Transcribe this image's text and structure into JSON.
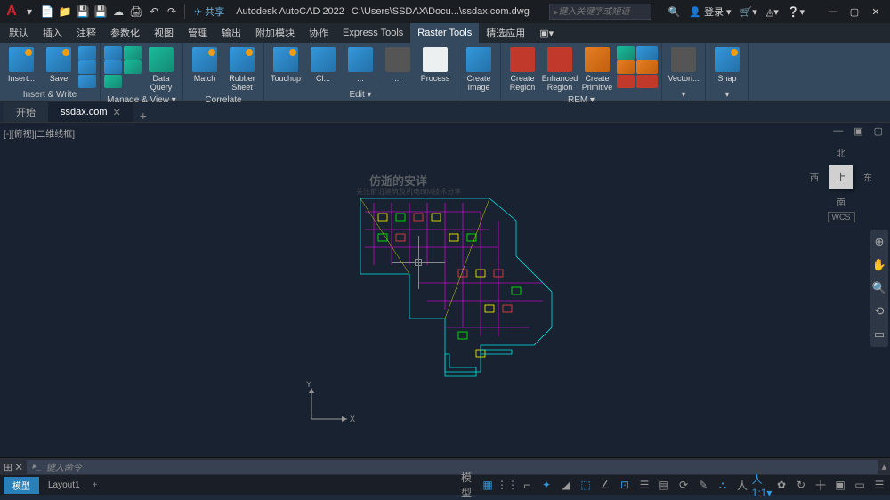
{
  "title": {
    "app": "Autodesk AutoCAD 2022",
    "file": "C:\\Users\\SSDAX\\Docu...\\ssdax.com.dwg",
    "share": "共享",
    "search_placeholder": "键入关键字或短语",
    "login": "登录"
  },
  "menu": {
    "items": [
      "默认",
      "插入",
      "注释",
      "参数化",
      "视图",
      "管理",
      "输出",
      "附加模块",
      "协作",
      "Express Tools",
      "Raster Tools",
      "精选应用"
    ],
    "active_index": 10
  },
  "ribbon": {
    "groups": [
      {
        "label": "Insert & Write",
        "buttons": [
          {
            "l": "Insert..."
          },
          {
            "l": "Save"
          }
        ]
      },
      {
        "label": "Manage & View ▾",
        "buttons": [
          {
            "l": "Data Query"
          }
        ]
      },
      {
        "label": "Correlate",
        "buttons": [
          {
            "l": "Match"
          },
          {
            "l": "Rubber Sheet"
          }
        ]
      },
      {
        "label": "Edit ▾",
        "buttons": [
          {
            "l": "Touchup"
          },
          {
            "l": "Cl..."
          },
          {
            "l": "..."
          },
          {
            "l": "..."
          },
          {
            "l": "Process"
          }
        ]
      },
      {
        "label": "",
        "buttons": [
          {
            "l": "Create Image"
          }
        ]
      },
      {
        "label": "REM ▾",
        "buttons": [
          {
            "l": "Create Region"
          },
          {
            "l": "Enhanced Region"
          },
          {
            "l": "Create Primitive"
          }
        ]
      },
      {
        "label": "▾",
        "buttons": [
          {
            "l": "Vectori..."
          }
        ]
      },
      {
        "label": "▾",
        "buttons": [
          {
            "l": "Snap"
          }
        ]
      }
    ]
  },
  "doctabs": {
    "tabs": [
      "开始",
      "ssdax.com"
    ],
    "active_index": 1
  },
  "viewport": {
    "label": "[-][俯视][二维线框]",
    "compass": {
      "n": "北",
      "s": "南",
      "e": "东",
      "w": "西",
      "face": "上"
    },
    "wcs": "WCS",
    "axes": {
      "x": "X",
      "y": "Y"
    }
  },
  "watermark": {
    "main": "仿逝的安详",
    "sub": "关注前沿建筑及机电BIM技术分享"
  },
  "command": {
    "placeholder": "键入命令"
  },
  "status": {
    "model": "模型",
    "layout": "Layout1"
  }
}
